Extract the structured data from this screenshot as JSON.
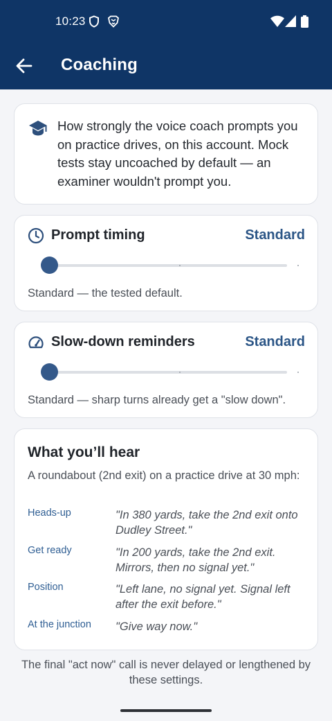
{
  "status_bar": {
    "time": "10:23"
  },
  "app_bar": {
    "title": "Coaching"
  },
  "intro": {
    "text": "How strongly the voice coach prompts you on practice drives, on this account. Mock tests stay uncoached by default — an examiner wouldn't prompt you."
  },
  "prompt_timing": {
    "title": "Prompt timing",
    "value": "Standard",
    "level": 0,
    "steps": 3,
    "description": "Standard — the tested default."
  },
  "slowdown": {
    "title": "Slow-down reminders",
    "value": "Standard",
    "level": 0,
    "steps": 3,
    "description": "Standard — sharp turns already get a \"slow down\"."
  },
  "hear": {
    "title": "What you’ll hear",
    "subtitle": "A roundabout (2nd exit) on a practice drive at 30 mph:",
    "rows": [
      {
        "label": "Heads-up",
        "quote": "\"In 380 yards, take the 2nd exit onto Dudley Street.\""
      },
      {
        "label": "Get ready",
        "quote": "\"In 200 yards, take the 2nd exit. Mirrors, then no signal yet.\""
      },
      {
        "label": "Position",
        "quote": "\"Left lane, no signal yet. Signal left after the exit before.\""
      },
      {
        "label": "At the junction",
        "quote": "\"Give way now.\""
      }
    ]
  },
  "footer": {
    "note": "The final \"act now\" call is never delayed or lengthened by these settings."
  },
  "colors": {
    "header": "#0f3566",
    "accent": "#2b5586",
    "thumb": "#34598a"
  },
  "icons": [
    "shield-outline-icon",
    "brave-logo-icon",
    "wifi-icon",
    "cellular-signal-icon",
    "battery-icon",
    "back-arrow-icon",
    "graduation-cap-icon",
    "clock-icon",
    "speedometer-icon"
  ]
}
